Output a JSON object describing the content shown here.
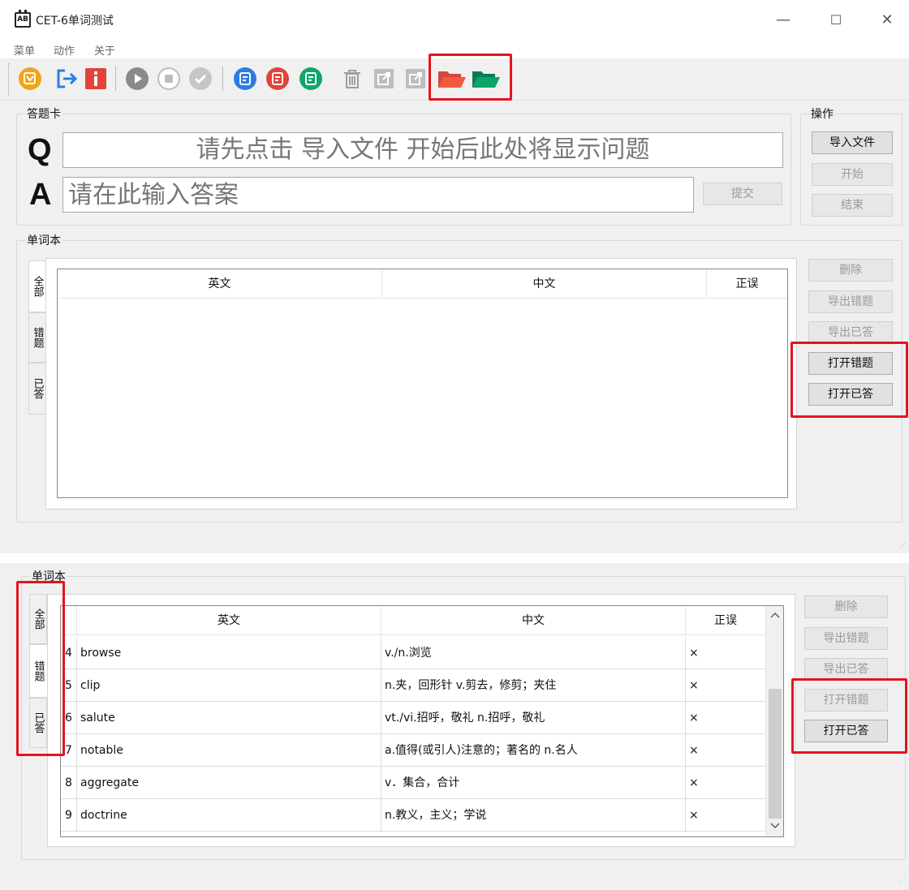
{
  "window": {
    "title": "CET-6单词测试",
    "icon_text": "AB",
    "minimize": "—",
    "maximize": "☐",
    "close": "✕"
  },
  "menu": [
    "菜单",
    "动作",
    "关于"
  ],
  "toolbar": {
    "icons": [
      "import-file-icon",
      "exit-icon",
      "info-icon",
      "start-icon",
      "stop-icon",
      "check-icon",
      "blue-edit-icon",
      "red-edit-icon",
      "green-edit-icon",
      "trash-icon",
      "export-icon",
      "export-answered-icon",
      "red-folder-icon",
      "green-folder-icon"
    ],
    "colors": {
      "orange": "#f2a31b",
      "blue": "#2c7be5",
      "red": "#e0443a",
      "green": "#12a56b",
      "gray": "#9e9e9e",
      "red_folder": "#f05a3e",
      "green_folder": "#0aa56a"
    }
  },
  "answer_card": {
    "legend": "答题卡",
    "q_label": "Q",
    "q_text": "请先点击 导入文件 开始后此处将显示问题",
    "a_label": "A",
    "a_placeholder": "请在此输入答案",
    "submit": "提交"
  },
  "operations": {
    "legend": "操作",
    "import": "导入文件",
    "start": "开始",
    "end": "结束"
  },
  "wordbook": {
    "legend": "单词本",
    "tabs": [
      "全部",
      "错题",
      "已答"
    ],
    "columns": [
      "英文",
      "中文",
      "正误"
    ],
    "buttons": {
      "delete": "删除",
      "export_wrong": "导出错题",
      "export_answered": "导出已答",
      "open_wrong": "打开错题",
      "open_answered": "打开已答"
    }
  },
  "wordbook2": {
    "legend": "单词本",
    "tabs": [
      "全部",
      "错题",
      "已答"
    ],
    "columns": [
      "英文",
      "中文",
      "正误"
    ],
    "rows": [
      {
        "num": "4",
        "en": "browse",
        "cn": "v./n.浏览",
        "mark": "×"
      },
      {
        "num": "5",
        "en": "clip",
        "cn": "n.夹，回形针 v.剪去，修剪；夹住",
        "mark": "×"
      },
      {
        "num": "6",
        "en": "salute",
        "cn": "vt./vi.招呼，敬礼 n.招呼，敬礼",
        "mark": "×"
      },
      {
        "num": "7",
        "en": "notable",
        "cn": "a.值得(或引人)注意的；著名的 n.名人",
        "mark": "×"
      },
      {
        "num": "8",
        "en": "aggregate",
        "cn": "v．集合，合计",
        "mark": "×"
      },
      {
        "num": "9",
        "en": "doctrine",
        "cn": "n.教义，主义；学说",
        "mark": "×"
      }
    ],
    "buttons": {
      "delete": "删除",
      "export_wrong": "导出错题",
      "export_answered": "导出已答",
      "open_wrong": "打开错题",
      "open_answered": "打开已答"
    }
  },
  "highlight_color": "#e3141f"
}
